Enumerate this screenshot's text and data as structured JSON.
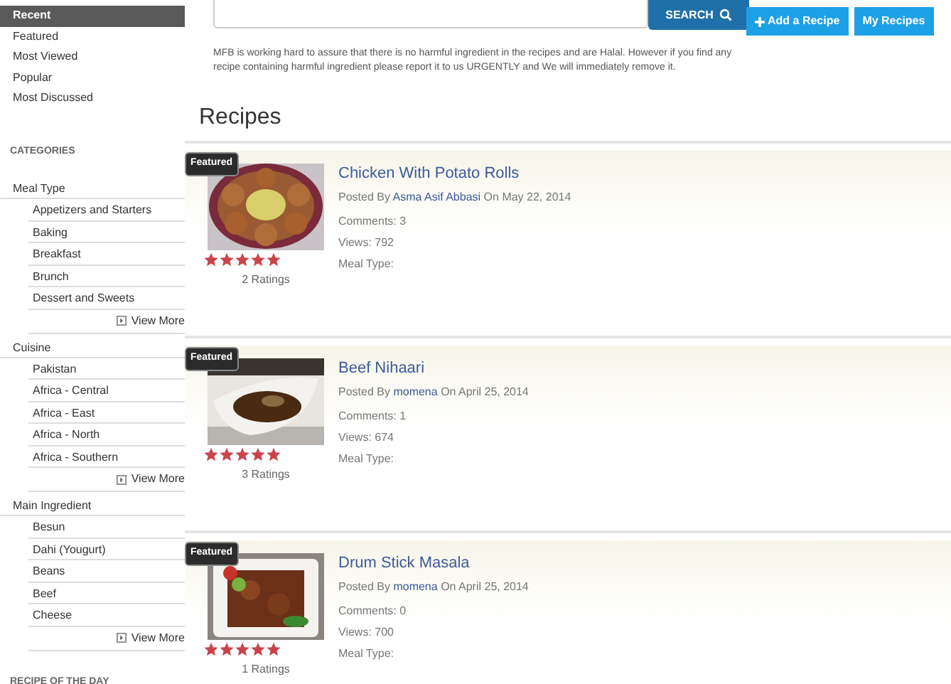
{
  "sidebar": {
    "filters": [
      {
        "label": "Recent",
        "selected": true
      },
      {
        "label": "Featured",
        "selected": false
      },
      {
        "label": "Most Viewed",
        "selected": false
      },
      {
        "label": "Popular",
        "selected": false
      },
      {
        "label": "Most Discussed",
        "selected": false
      }
    ],
    "categories_heading": "CATEGORIES",
    "categories": [
      {
        "label": "Meal Type",
        "children": [
          "Appetizers and Starters",
          "Baking",
          "Breakfast",
          "Brunch",
          "Dessert and Sweets"
        ],
        "view_more": "View More"
      },
      {
        "label": "Cuisine",
        "children": [
          "Pakistan",
          "Africa - Central",
          "Africa - East",
          "Africa - North",
          "Africa - Southern"
        ],
        "view_more": "View More"
      },
      {
        "label": "Main Ingredient",
        "children": [
          "Besun",
          "Dahi (Yougurt)",
          "Beans",
          "Beef",
          "Cheese"
        ],
        "view_more": "View More"
      }
    ],
    "recipe_of_day_heading": "RECIPE OF THE DAY"
  },
  "search": {
    "button": "SEARCH"
  },
  "actions": [
    {
      "label": "Add a Recipe",
      "kind": "add"
    },
    {
      "label": "My Recipes",
      "kind": "plain"
    }
  ],
  "notice": "MFB is working hard to assure that there is no harmful ingredient in the recipes and are Halal. However if you find any recipe containing harmful ingredient please report it to us URGENTLY and We will immediately remove it.",
  "heading": "Recipes",
  "recipes": [
    {
      "badge": "Featured",
      "title": "Chicken With Potato Rolls",
      "posted_by": "Posted By",
      "author": "Asma Asif Abbasi",
      "date": "On May 22, 2014",
      "comments": "Comments: 3",
      "views": "Views: 792",
      "meal_type": "Meal Type:",
      "stars": 5,
      "ratings": "2 Ratings",
      "kind": "plate"
    },
    {
      "badge": "Featured",
      "title": "Beef Nihaari",
      "posted_by": "Posted By",
      "author": "momena",
      "date": "On April 25, 2014",
      "comments": "Comments: 1",
      "views": "Views: 674",
      "meal_type": "Meal Type:",
      "stars": 5,
      "ratings": "3 Ratings",
      "kind": "bowl"
    },
    {
      "badge": "Featured",
      "title": "Drum Stick Masala",
      "posted_by": "Posted By",
      "author": "momena",
      "date": "On April 25, 2014",
      "comments": "Comments: 0",
      "views": "Views: 700",
      "meal_type": "Meal Type:",
      "stars": 5,
      "ratings": "1 Ratings",
      "kind": "dish"
    }
  ]
}
